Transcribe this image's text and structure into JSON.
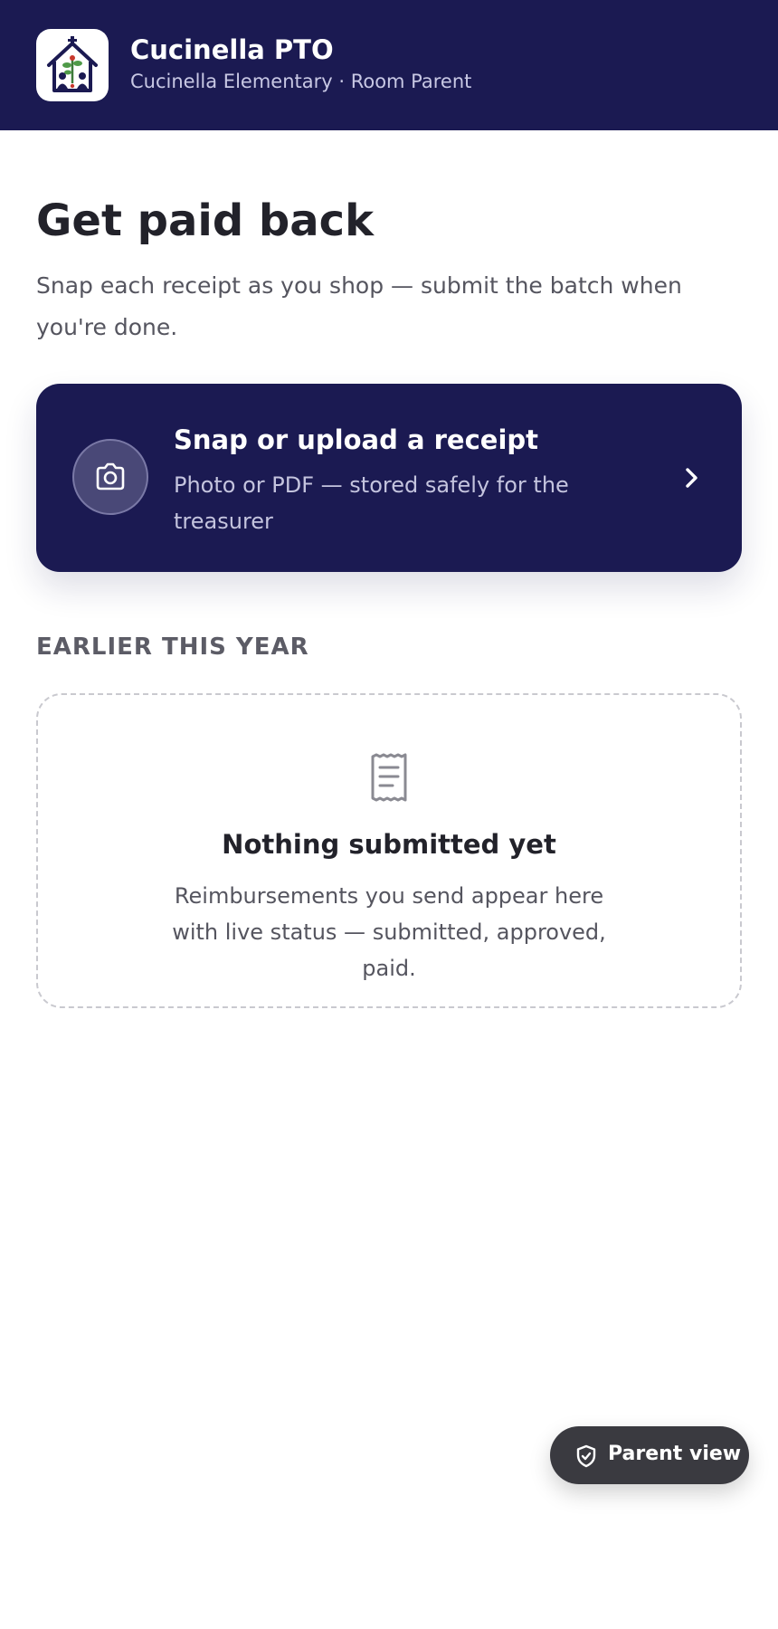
{
  "header": {
    "org_name": "Cucinella PTO",
    "org_subtitle": "Cucinella Elementary · Room Parent",
    "logo_icon": "school-house-logo"
  },
  "main": {
    "title": "Get paid back",
    "subtitle": "Snap each receipt as you shop — submit the batch when you're done.",
    "upload_card": {
      "title": "Snap or upload a receipt",
      "subtitle": "Photo or PDF — stored safely for the treasurer",
      "icon": "camera-icon",
      "action_icon": "chevron-right-icon"
    },
    "history": {
      "section_label": "EARLIER THIS YEAR",
      "empty_icon": "receipt-icon",
      "empty_title": "Nothing submitted yet",
      "empty_subtitle": "Reimbursements you send appear here with live status — submitted, approved, paid."
    }
  },
  "floating": {
    "parent_view_label": "Parent view",
    "icon": "shield-check-icon"
  },
  "colors": {
    "brand_navy": "#1b1a52",
    "pill_dark": "#3a3a40",
    "text_primary": "#22222a",
    "text_secondary": "#55555f"
  }
}
